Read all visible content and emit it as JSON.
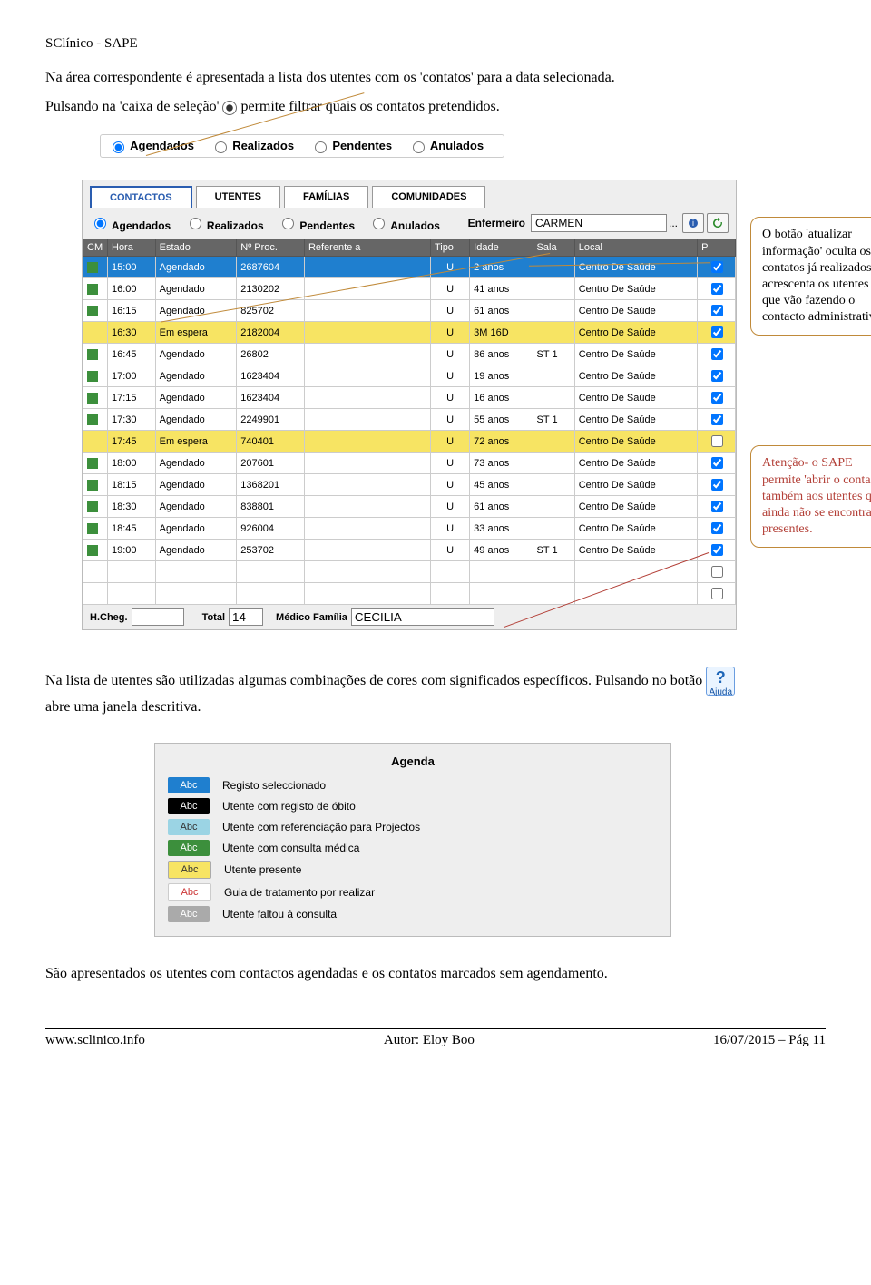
{
  "header": "SClínico - SAPE",
  "p1": "Na área correspondente é apresentada a lista dos utentes com os 'contatos' para a data selecionada.",
  "p2a": "Pulsando na 'caixa de seleção'",
  "p2b": "permite filtrar quais os contatos pretendidos.",
  "radios": {
    "r1": "Agendados",
    "r2": "Realizados",
    "r3": "Pendentes",
    "r4": "Anulados"
  },
  "tabs": {
    "t1": "CONTACTOS",
    "t2": "UTENTES",
    "t3": "FAMÍLIAS",
    "t4": "COMUNIDADES"
  },
  "enfLabel": "Enfermeiro",
  "enfValue": "CARMEN",
  "cols": {
    "cm": "CM",
    "hora": "Hora",
    "estado": "Estado",
    "proc": "Nº Proc.",
    "ref": "Referente a",
    "tipo": "Tipo",
    "idade": "Idade",
    "sala": "Sala",
    "local": "Local",
    "p": "P"
  },
  "rows": [
    {
      "cm": "g",
      "hora": "15:00",
      "estado": "Agendado",
      "proc": "2687604",
      "tipo": "U",
      "idade": "2 anos",
      "sala": "",
      "local": "Centro De Saúde",
      "p": true,
      "sel": true
    },
    {
      "cm": "g",
      "hora": "16:00",
      "estado": "Agendado",
      "proc": "2130202",
      "tipo": "U",
      "idade": "41 anos",
      "sala": "",
      "local": "Centro De Saúde",
      "p": true
    },
    {
      "cm": "g",
      "hora": "16:15",
      "estado": "Agendado",
      "proc": "825702",
      "tipo": "U",
      "idade": "61 anos",
      "sala": "",
      "local": "Centro De Saúde",
      "p": true
    },
    {
      "cm": "y",
      "hora": "16:30",
      "estado": "Em espera",
      "proc": "2182004",
      "tipo": "U",
      "idade": "3M 16D",
      "sala": "",
      "local": "Centro De Saúde",
      "p": true,
      "esp": true
    },
    {
      "cm": "g",
      "hora": "16:45",
      "estado": "Agendado",
      "proc": "26802",
      "tipo": "U",
      "idade": "86 anos",
      "sala": "ST 1",
      "local": "Centro De Saúde",
      "p": true
    },
    {
      "cm": "g",
      "hora": "17:00",
      "estado": "Agendado",
      "proc": "1623404",
      "tipo": "U",
      "idade": "19 anos",
      "sala": "",
      "local": "Centro De Saúde",
      "p": true
    },
    {
      "cm": "g",
      "hora": "17:15",
      "estado": "Agendado",
      "proc": "1623404",
      "tipo": "U",
      "idade": "16 anos",
      "sala": "",
      "local": "Centro De Saúde",
      "p": true
    },
    {
      "cm": "g",
      "hora": "17:30",
      "estado": "Agendado",
      "proc": "2249901",
      "tipo": "U",
      "idade": "55 anos",
      "sala": "ST 1",
      "local": "Centro De Saúde",
      "p": true
    },
    {
      "cm": "y",
      "hora": "17:45",
      "estado": "Em espera",
      "proc": "740401",
      "tipo": "U",
      "idade": "72 anos",
      "sala": "",
      "local": "Centro De Saúde",
      "p": false,
      "esp": true
    },
    {
      "cm": "g",
      "hora": "18:00",
      "estado": "Agendado",
      "proc": "207601",
      "tipo": "U",
      "idade": "73 anos",
      "sala": "",
      "local": "Centro De Saúde",
      "p": true
    },
    {
      "cm": "g",
      "hora": "18:15",
      "estado": "Agendado",
      "proc": "1368201",
      "tipo": "U",
      "idade": "45 anos",
      "sala": "",
      "local": "Centro De Saúde",
      "p": true
    },
    {
      "cm": "g",
      "hora": "18:30",
      "estado": "Agendado",
      "proc": "838801",
      "tipo": "U",
      "idade": "61 anos",
      "sala": "",
      "local": "Centro De Saúde",
      "p": true
    },
    {
      "cm": "g",
      "hora": "18:45",
      "estado": "Agendado",
      "proc": "926004",
      "tipo": "U",
      "idade": "33 anos",
      "sala": "",
      "local": "Centro De Saúde",
      "p": true
    },
    {
      "cm": "g",
      "hora": "19:00",
      "estado": "Agendado",
      "proc": "253702",
      "tipo": "U",
      "idade": "49 anos",
      "sala": "ST 1",
      "local": "Centro De Saúde",
      "p": true
    },
    {
      "cm": "",
      "hora": "",
      "estado": "",
      "proc": "",
      "tipo": "",
      "idade": "",
      "sala": "",
      "local": "",
      "p": false
    },
    {
      "cm": "",
      "hora": "",
      "estado": "",
      "proc": "",
      "tipo": "",
      "idade": "",
      "sala": "",
      "local": "",
      "p": false
    }
  ],
  "bottom": {
    "hcheg": "H.Cheg.",
    "total": "Total",
    "totalVal": "14",
    "medico": "Médico Família",
    "medicoVal": "CECILIA"
  },
  "callout1": "O botão 'atualizar informação' oculta os contatos  já realizados e acrescenta os utentes que vão fazendo o contacto administrativo",
  "callout2": "Atenção-  o SAPE permite 'abrir o contacto' também aos utentes que ainda não se encontram presentes.",
  "p3a": "Na lista de utentes são utilizadas algumas combinações de cores com significados específicos. Pulsando no botão",
  "p3b": "abre uma janela descritiva.",
  "helpLabel": "Ajuda",
  "legend": {
    "title": "Agenda",
    "r": [
      {
        "cls": "sw-blue",
        "t": "Abc",
        "d": "Registo seleccionado"
      },
      {
        "cls": "sw-black",
        "t": "Abc",
        "d": "Utente com registo de óbito"
      },
      {
        "cls": "sw-cyan",
        "t": "Abc",
        "d": "Utente com referenciação para Projectos"
      },
      {
        "cls": "sw-green",
        "t": "Abc",
        "d": "Utente com consulta médica"
      },
      {
        "cls": "sw-yellow",
        "t": "Abc",
        "d": "Utente presente"
      },
      {
        "cls": "sw-red",
        "t": "Abc",
        "d": "Guia de tratamento por realizar"
      },
      {
        "cls": "sw-grey",
        "t": "Abc",
        "d": "Utente faltou à consulta"
      }
    ]
  },
  "p4": "São apresentados os utentes com contactos agendadas e os contatos marcados sem agendamento.",
  "footer": {
    "left": "www.sclinico.info",
    "center": "Autor: Eloy Boo",
    "right": "16/07/2015 – Pág  11"
  }
}
